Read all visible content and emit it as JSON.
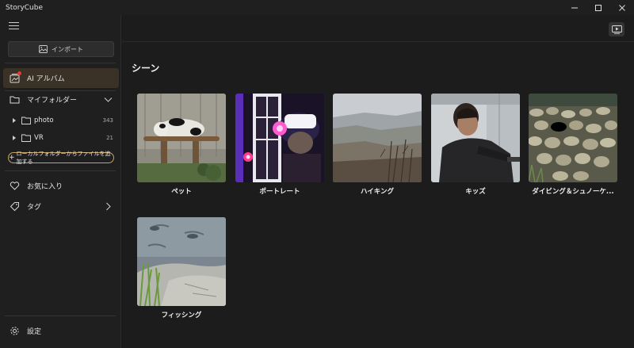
{
  "app": {
    "title": "StoryCube"
  },
  "sidebar": {
    "import_label": "インポート",
    "ai_album_label": "AI アルバム",
    "my_folders_label": "マイフォルダー",
    "folders": [
      {
        "name": "photo",
        "count": "343"
      },
      {
        "name": "VR",
        "count": "21"
      }
    ],
    "add_folder_label": "ローカルフォルダーからファイルを追加する",
    "favorites_label": "お気に入り",
    "tags_label": "タグ",
    "settings_label": "設定"
  },
  "main": {
    "section_title": "シーン",
    "scenes": [
      {
        "label": "ペット"
      },
      {
        "label": "ポートレート"
      },
      {
        "label": "ハイキング"
      },
      {
        "label": "キッズ"
      },
      {
        "label": "ダイビング＆シュノーケ..."
      },
      {
        "label": "フィッシング"
      }
    ]
  },
  "colors": {
    "accent": "#c8a062",
    "active_bg": "#3a3127",
    "badge": "#e03a3a"
  }
}
